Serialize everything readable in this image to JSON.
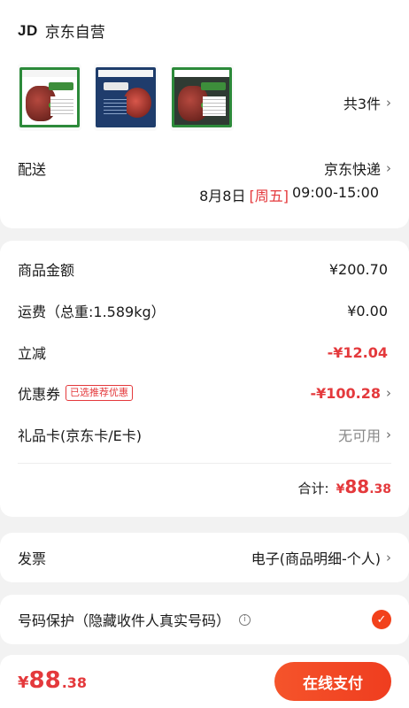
{
  "shop": {
    "logo": "JD",
    "name": "京东自营"
  },
  "products": {
    "thumbnails": [
      "product-thumb-1",
      "product-thumb-2",
      "product-thumb-3"
    ],
    "count_label": "共3件"
  },
  "delivery": {
    "label": "配送",
    "carrier": "京东快递",
    "date": "8月8日",
    "weekday": "[周五]",
    "time": "09:00-15:00"
  },
  "costs": {
    "goods_label": "商品金额",
    "goods_value": "¥200.70",
    "shipping_label": "运费（总重:1.589kg）",
    "shipping_value": "¥0.00",
    "discount_label": "立减",
    "discount_value": "-¥12.04",
    "coupon_label": "优惠券",
    "coupon_badge": "已选推荐优惠",
    "coupon_value": "-¥100.28",
    "giftcard_label": "礼品卡(京东卡/E卡)",
    "giftcard_value": "无可用",
    "total_label": "合计:",
    "total_yen": "¥",
    "total_int": "88",
    "total_dec": ".38"
  },
  "invoice": {
    "label": "发票",
    "value": "电子(商品明细-个人)"
  },
  "privacy": {
    "label": "号码保护（隐藏收件人真实号码）",
    "checked": true
  },
  "footer": {
    "yen": "¥",
    "amount_int": "88",
    "amount_dec": ".38",
    "pay_label": "在线支付"
  },
  "colors": {
    "accent": "#e4393c",
    "button": "#f2411b"
  }
}
